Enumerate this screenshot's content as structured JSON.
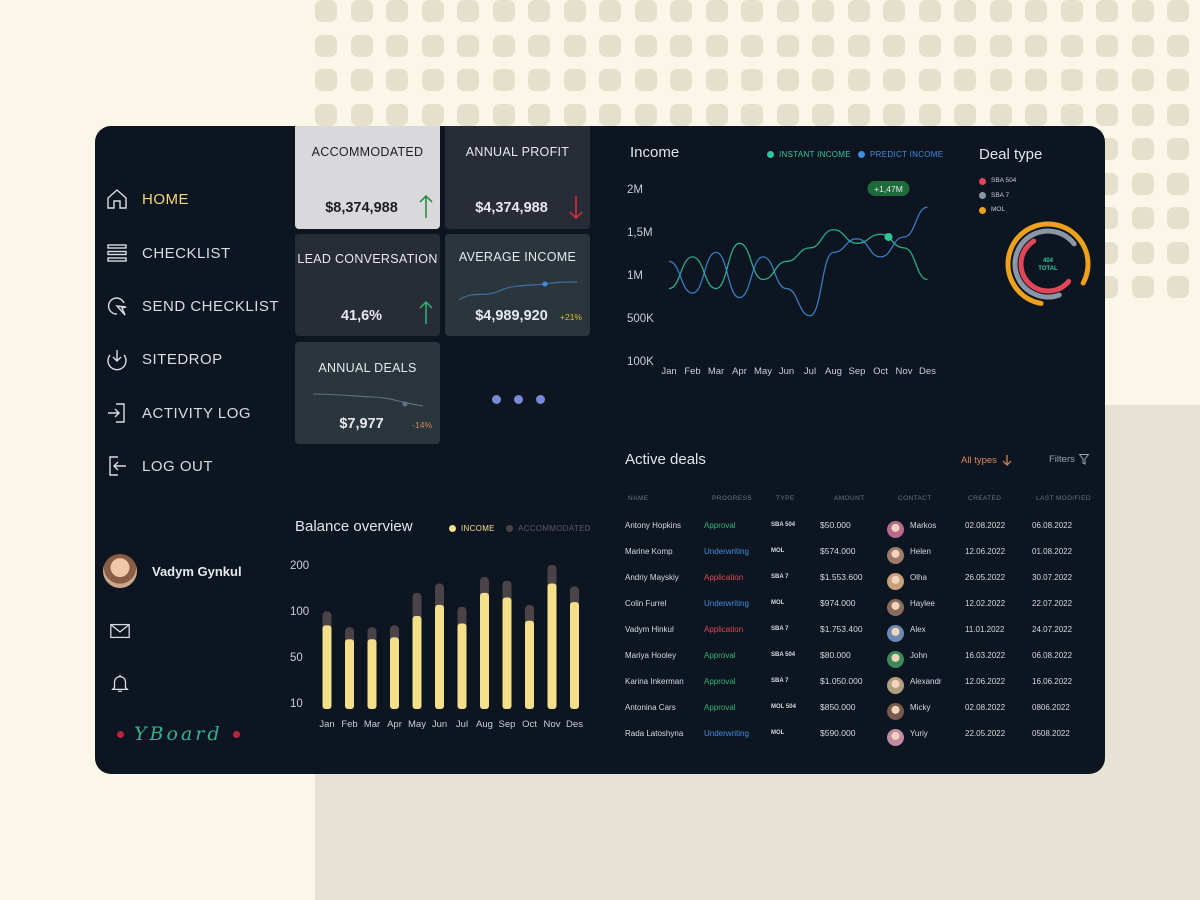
{
  "sidebar": {
    "items": [
      {
        "label": "HOME",
        "icon": "home-icon",
        "active": true
      },
      {
        "label": "CHECKLIST",
        "icon": "list-icon"
      },
      {
        "label": "SEND CHECKLIST",
        "icon": "send-icon"
      },
      {
        "label": "SITEDROP",
        "icon": "download-icon"
      },
      {
        "label": "ACTIVITY LOG",
        "icon": "login-icon"
      },
      {
        "label": "LOG OUT",
        "icon": "logout-icon"
      }
    ],
    "user_name": "Vadym Gynkul",
    "brand": "YBoard"
  },
  "stats": [
    {
      "title": "ACCOMMODATED",
      "value": "$8,374,988",
      "trend": "up"
    },
    {
      "title": "ANNUAL PROFIT",
      "value": "$4,374,988",
      "trend": "down"
    },
    {
      "title": "LEAD CONVERSATION",
      "value": "41,6%",
      "trend": "up"
    },
    {
      "title": "AVERAGE INCOME",
      "value": "$4,989,920",
      "pct": "+21%"
    },
    {
      "title": "ANNUAL DEALS",
      "value": "$7,977",
      "pct": "-14%"
    }
  ],
  "income": {
    "title": "Income",
    "legend": [
      "INSTANT INCOME",
      "PREDICT INCOME"
    ],
    "tooltip": "+1,47M",
    "y_ticks": [
      "2M",
      "1,5M",
      "1M",
      "500K",
      "100K"
    ],
    "months": [
      "Jan",
      "Feb",
      "Mar",
      "Apr",
      "May",
      "Jun",
      "Jul",
      "Aug",
      "Sep",
      "Oct",
      "Nov",
      "Des"
    ]
  },
  "deal_type": {
    "title": "Deal type",
    "legend": [
      "SBA 504",
      "SBA 7",
      "MOL"
    ],
    "total": "404",
    "total_label": "TOTAL"
  },
  "balance": {
    "title": "Balance overview",
    "legend": [
      "INCOME",
      "ACCOMMODATED"
    ],
    "y_ticks": [
      "200",
      "100",
      "50",
      "10"
    ]
  },
  "chart_data": [
    {
      "type": "line",
      "title": "Income",
      "x": [
        "Jan",
        "Feb",
        "Mar",
        "Apr",
        "May",
        "Jun",
        "Jul",
        "Aug",
        "Sep",
        "Oct",
        "Nov",
        "Des"
      ],
      "y_ticks": [
        "2M",
        "1,5M",
        "1M",
        "500K",
        "100K"
      ],
      "series": [
        {
          "name": "INSTANT INCOME",
          "values": [
            0.9,
            1.25,
            0.9,
            1.4,
            1.0,
            1.2,
            1.35,
            1.55,
            1.4,
            1.5,
            1.35,
            1.0
          ]
        },
        {
          "name": "PREDICT INCOME",
          "values": [
            1.2,
            0.85,
            1.3,
            0.8,
            1.25,
            0.9,
            0.6,
            1.3,
            1.45,
            1.25,
            1.47,
            1.8
          ]
        }
      ],
      "annotation": "+1,47M"
    },
    {
      "type": "pie",
      "title": "Deal type",
      "categories": [
        "SBA 504",
        "SBA 7",
        "MOL"
      ],
      "values": [
        0.55,
        0.7,
        0.8
      ],
      "colors": [
        "#e0485a",
        "#8a97a6",
        "#f0a11c"
      ],
      "center_text": "404 TOTAL"
    },
    {
      "type": "bar",
      "title": "Balance overview",
      "categories": [
        "Jan",
        "Feb",
        "Mar",
        "Apr",
        "May",
        "Jun",
        "Jul",
        "Aug",
        "Sep",
        "Oct",
        "Nov",
        "Des"
      ],
      "y_ticks": [
        "200",
        "100",
        "50",
        "10"
      ],
      "series": [
        {
          "name": "INCOME",
          "values": [
            90,
            75,
            75,
            77,
            100,
            112,
            92,
            125,
            120,
            95,
            135,
            115
          ],
          "color": "#f4e08a"
        },
        {
          "name": "ACCOMMODATED",
          "values": [
            105,
            88,
            88,
            90,
            125,
            135,
            110,
            142,
            138,
            112,
            155,
            132
          ],
          "color": "#4a4348"
        }
      ],
      "ylim": [
        0,
        170
      ]
    }
  ],
  "deals": {
    "title": "Active deals",
    "filter_label": "All types",
    "filters_label": "Filters",
    "columns": [
      "NAME",
      "PROGRESS",
      "TYPE",
      "AMOUNT",
      "CONTACT",
      "CREATED",
      "LAST MODIFIED"
    ],
    "rows": [
      {
        "name": "Antony Hopkins",
        "progress": "Approval",
        "type": "SBA 504",
        "amount": "$50.000",
        "contact": "Markos",
        "created": "02.08.2022",
        "modified": "06.08.2022"
      },
      {
        "name": "Marine Komp",
        "progress": "Underwriting",
        "type": "MOL",
        "amount": "$574.000",
        "contact": "Helen",
        "created": "12.06.2022",
        "modified": "01.08.2022"
      },
      {
        "name": "Andriy Mayskiy",
        "progress": "Application",
        "type": "SBA 7",
        "amount": "$1.553.600",
        "contact": "Olha",
        "created": "26.05.2022",
        "modified": "30.07.2022"
      },
      {
        "name": "Colin Furrel",
        "progress": "Underwriting",
        "type": "MOL",
        "amount": "$974.000",
        "contact": "Haylee",
        "created": "12.02.2022",
        "modified": "22.07.2022"
      },
      {
        "name": "Vadym Hinkul",
        "progress": "Application",
        "type": "SBA 7",
        "amount": "$1.753.400",
        "contact": "Alex",
        "created": "11.01.2022",
        "modified": "24.07.2022"
      },
      {
        "name": "Mariya Hooley",
        "progress": "Approval",
        "type": "SBA 504",
        "amount": "$80.000",
        "contact": "John",
        "created": "16.03.2022",
        "modified": "06.08.2022"
      },
      {
        "name": "Karina Inkerman",
        "progress": "Approval",
        "type": "SBA 7",
        "amount": "$1.050.000",
        "contact": "Alexandr",
        "created": "12.06.2022",
        "modified": "16.06.2022"
      },
      {
        "name": "Antonina Cars",
        "progress": "Approval",
        "type": "MOL 504",
        "amount": "$850.000",
        "contact": "Micky",
        "created": "02.08.2022",
        "modified": "0806.2022"
      },
      {
        "name": "Rada Latoshyna",
        "progress": "Underwriting",
        "type": "MOL",
        "amount": "$590.000",
        "contact": "Yuriy",
        "created": "22.05.2022",
        "modified": "0508.2022"
      }
    ]
  },
  "colors": {
    "panel": "#0d1520",
    "accent_yellow": "#f4d77c",
    "approval": "#2fb37a",
    "underwriting": "#3f8ee0",
    "application": "#e0485a"
  }
}
